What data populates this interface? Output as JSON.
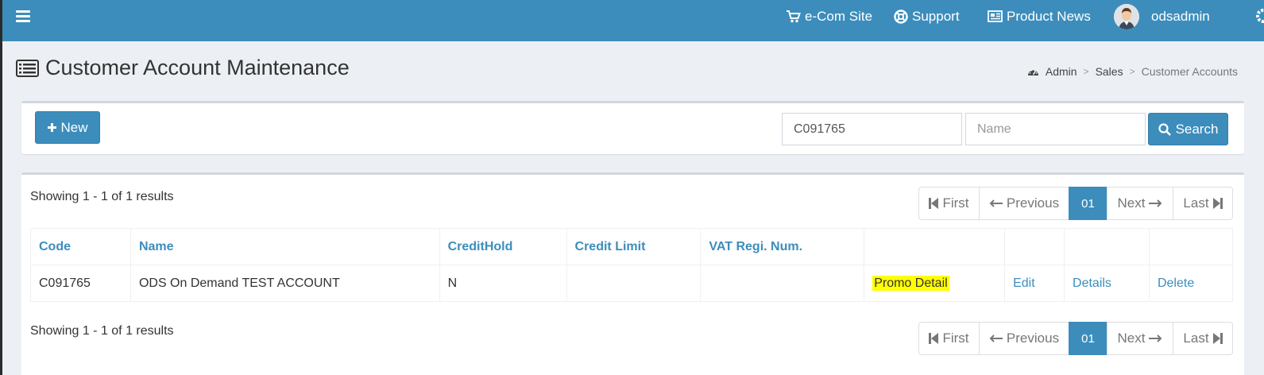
{
  "topbar": {
    "ecom_label": "e-Com Site",
    "support_label": "Support",
    "news_label": "Product News",
    "username": "odsadmin",
    "bg_color": "#3c8dbc"
  },
  "header": {
    "title": "Customer Account Maintenance",
    "breadcrumb": [
      "Admin",
      "Sales",
      "Customer Accounts"
    ]
  },
  "toolbar": {
    "new_label": "New",
    "code_value": "C091765",
    "name_placeholder": "Name",
    "search_label": "Search"
  },
  "results": {
    "summary": "Showing 1 - 1 of 1 results",
    "pager": {
      "first": "First",
      "previous": "Previous",
      "current": "01",
      "next": "Next",
      "last": "Last"
    },
    "columns": [
      "Code",
      "Name",
      "CreditHold",
      "Credit Limit",
      "VAT Regi. Num.",
      "",
      "",
      "",
      ""
    ],
    "rows": [
      {
        "code": "C091765",
        "name": "ODS On Demand TEST ACCOUNT",
        "credit_hold": "N",
        "credit_limit": "",
        "vat": "",
        "promo": "Promo Detail",
        "edit": "Edit",
        "details": "Details",
        "delete": "Delete"
      }
    ]
  }
}
